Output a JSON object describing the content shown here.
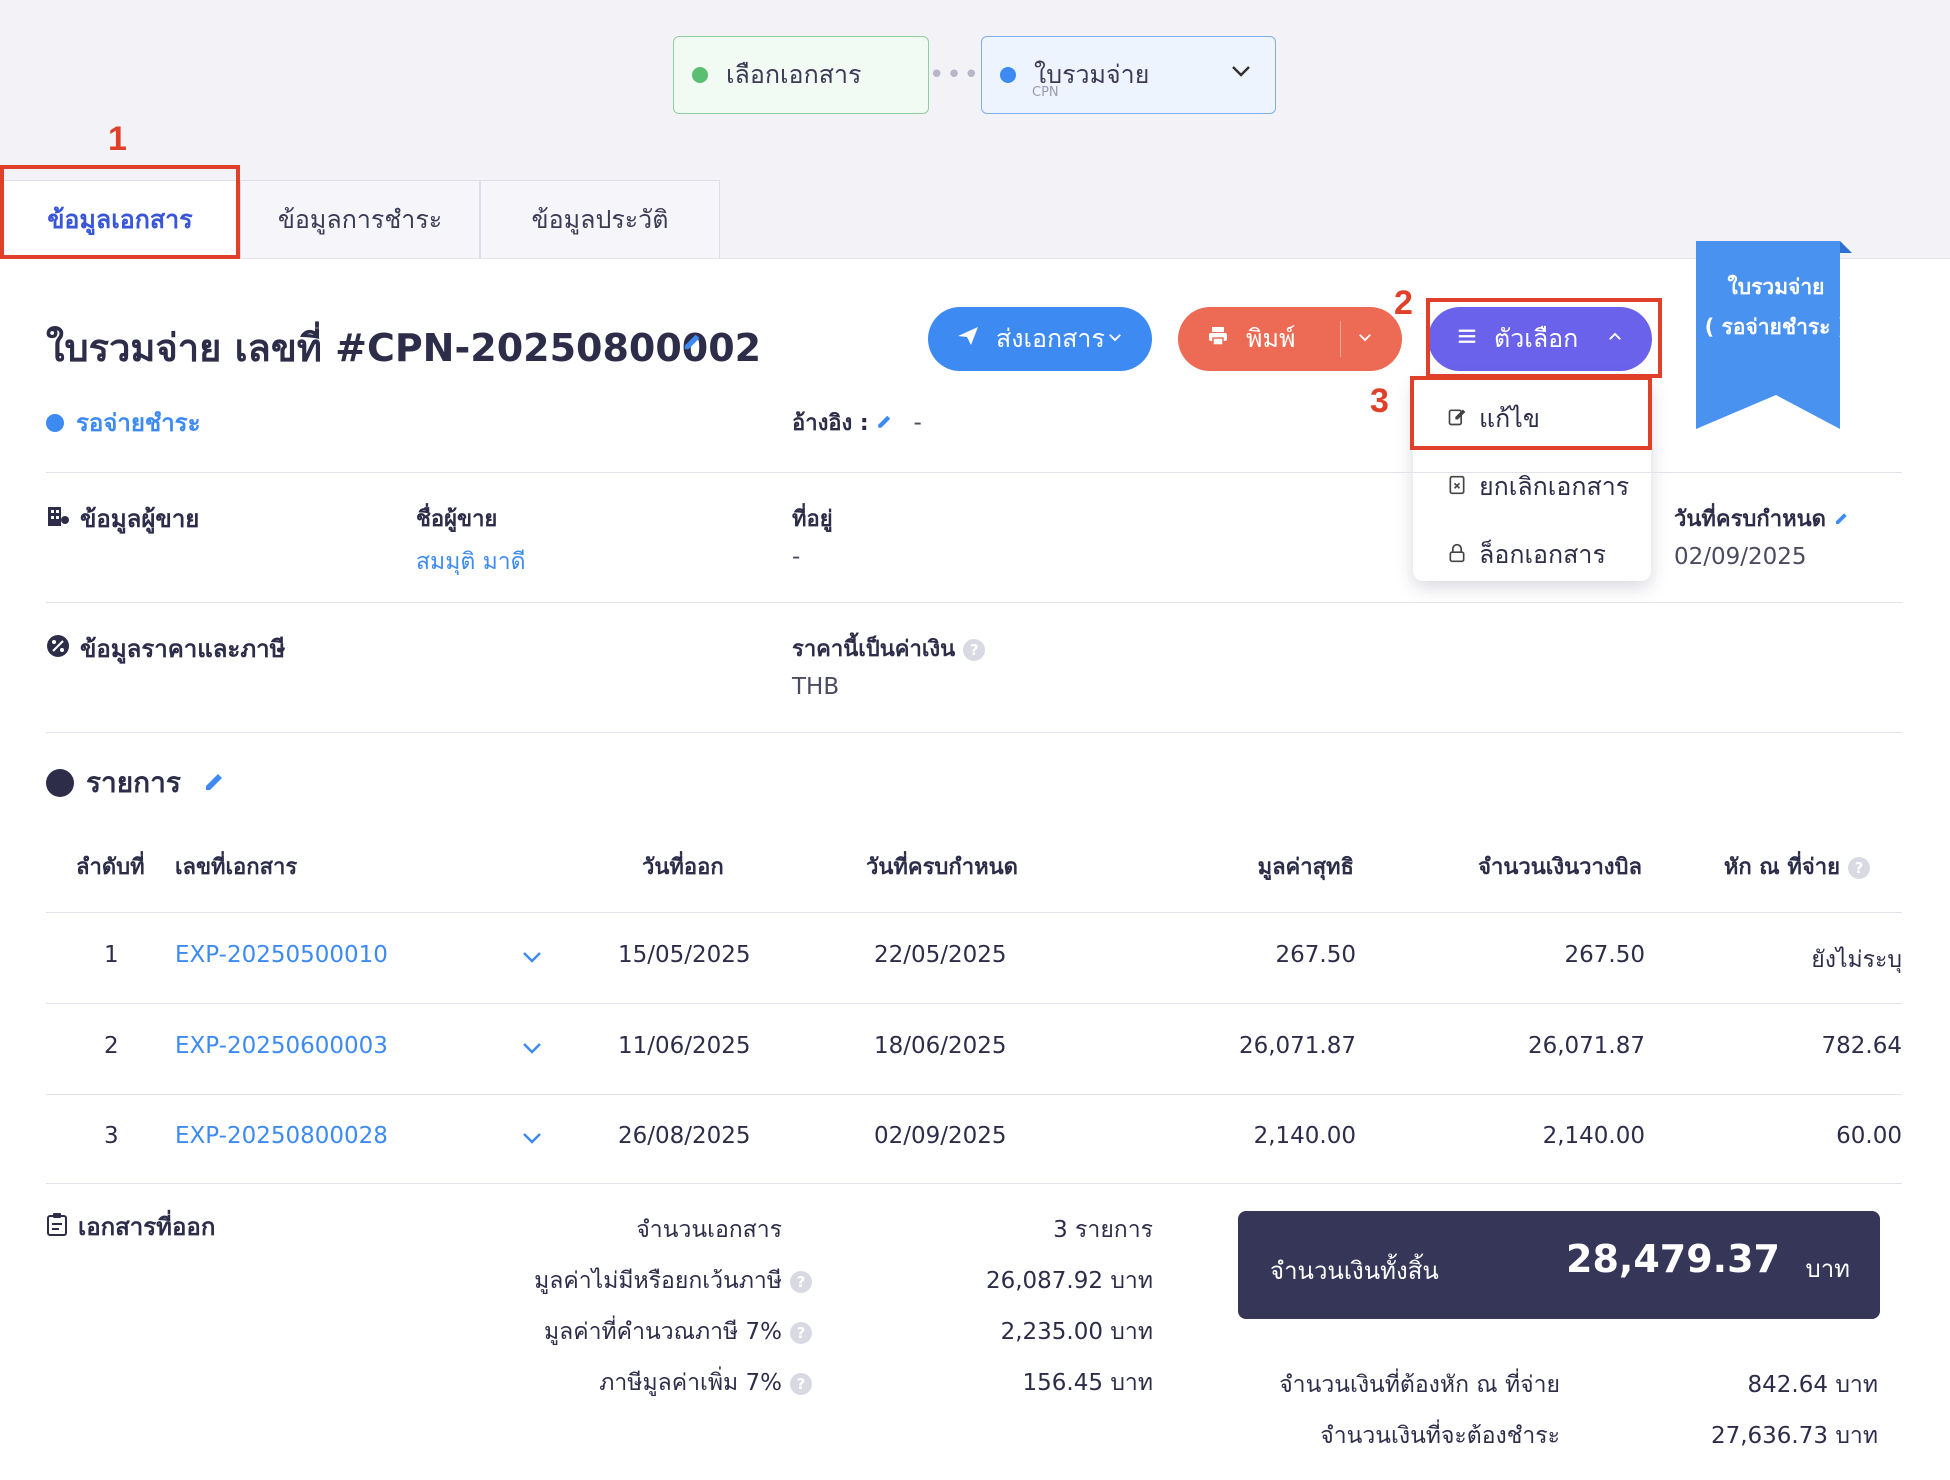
{
  "steps": {
    "step1_label": "เลือกเอกสาร",
    "step2_label": "ใบรวมจ่าย",
    "step2_sub": "CPN",
    "separator": "•••"
  },
  "annotations": {
    "n1": "1",
    "n2": "2",
    "n3": "3"
  },
  "tabs": [
    {
      "label": "ข้อมูลเอกสาร"
    },
    {
      "label": "ข้อมูลการชำระ"
    },
    {
      "label": "ข้อมูลประวัติ"
    }
  ],
  "header": {
    "title": "ใบรวมจ่าย เลขที่ #CPN-20250800002",
    "status": "รอจ่ายชำระ",
    "ref_label": "อ้างอิง :",
    "ref_value": "-"
  },
  "buttons": {
    "send": "ส่งเอกสาร",
    "print": "พิมพ์",
    "options": "ตัวเลือก"
  },
  "dropdown": {
    "edit": "แก้ไข",
    "cancel": "ยกเลิกเอกสาร",
    "lock": "ล็อกเอกสาร"
  },
  "ribbon": {
    "line1": "ใบรวมจ่าย",
    "line2": "( รอจ่ายชำระ )"
  },
  "seller": {
    "section": "ข้อมูลผู้ขาย",
    "name_label": "ชื่อผู้ขาย",
    "name": "สมมุติ มาดี",
    "address_label": "ที่อยู่",
    "address": "-",
    "due_label": "วันที่ครบกำหนด",
    "due": "02/09/2025"
  },
  "price": {
    "section": "ข้อมูลราคาและภาษี",
    "currency_label": "ราคานี้เป็นค่าเงิน",
    "currency": "THB"
  },
  "items": {
    "title": "รายการ",
    "headers": [
      "ลำดับที่",
      "เลขที่เอกสาร",
      "วันที่ออก",
      "วันที่ครบกำหนด",
      "มูลค่าสุทธิ",
      "จำนวนเงินวางบิล",
      "หัก ณ ที่จ่าย"
    ],
    "rows": [
      {
        "no": "1",
        "doc": "EXP-20250500010",
        "issued": "15/05/2025",
        "due": "22/05/2025",
        "net": "267.50",
        "billed": "267.50",
        "wht": "ยังไม่ระบุ"
      },
      {
        "no": "2",
        "doc": "EXP-20250600003",
        "issued": "11/06/2025",
        "due": "18/06/2025",
        "net": "26,071.87",
        "billed": "26,071.87",
        "wht": "782.64"
      },
      {
        "no": "3",
        "doc": "EXP-20250800028",
        "issued": "26/08/2025",
        "due": "02/09/2025",
        "net": "2,140.00",
        "billed": "2,140.00",
        "wht": "60.00"
      }
    ]
  },
  "summary": {
    "section": "เอกสารที่ออก",
    "doc_count_label": "จำนวนเอกสาร",
    "doc_count": "3 รายการ",
    "nontax_label": "มูลค่าไม่มีหรือยกเว้นภาษี",
    "nontax": "26,087.92 บาท",
    "taxable_label": "มูลค่าที่คำนวณภาษี 7%",
    "taxable": "2,235.00 บาท",
    "vat_label": "ภาษีมูลค่าเพิ่ม 7%",
    "vat": "156.45 บาท",
    "total_label": "จำนวนเงินทั้งสิ้น",
    "total": "28,479.37",
    "total_unit": "บาท",
    "wht_label": "จำนวนเงินที่ต้องหัก ณ ที่จ่าย",
    "wht": "842.64 บาท",
    "payable_label": "จำนวนเงินที่จะต้องชำระ",
    "payable": "27,636.73 บาท"
  },
  "colors": {
    "accent": "#3d8bf2",
    "print": "#ed6b55",
    "options": "#6a62ea",
    "annotation": "#e0402a",
    "total_bg": "#363659"
  }
}
